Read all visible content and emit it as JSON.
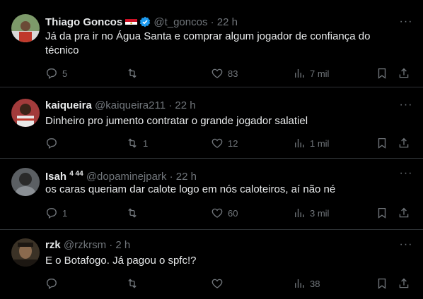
{
  "colors": {
    "background": "#000000",
    "text": "#e7e9ea",
    "muted": "#71767b",
    "verified": "#1d9bf0",
    "divider": "#2f3336"
  },
  "tweets": [
    {
      "name": "Thiago Goncos",
      "handle": "@t_goncos",
      "sep": "·",
      "time": "22 h",
      "badges": [
        "egypt-flag-icon",
        "verified-badge-icon"
      ],
      "text": "Já da pra ir no Água Santa e comprar algum jogador de confiança do técnico",
      "replies": "5",
      "retweets": "",
      "likes": "83",
      "views": "7 mil"
    },
    {
      "name": "kaiqueira",
      "handle": "@kaiqueira211",
      "sep": "·",
      "time": "22 h",
      "text": "Dinheiro pro jumento contratar o grande jogador salatiel",
      "replies": "",
      "retweets": "1",
      "likes": "12",
      "views": "1 mil"
    },
    {
      "name": "Isah",
      "name_sup": "4 44",
      "handle": "@dopaminejpark",
      "sep": "·",
      "time": "22 h",
      "text": "os caras queriam dar calote logo em nós caloteiros, aí não né",
      "replies": "1",
      "retweets": "",
      "likes": "60",
      "views": "3 mil"
    },
    {
      "name": "rzk",
      "handle": "@rzkrsm",
      "sep": "·",
      "time": "2 h",
      "text": "E o Botafogo. Já pagou o spfc!?",
      "replies": "",
      "retweets": "",
      "likes": "",
      "views": "38"
    }
  ],
  "more_glyph": "···"
}
